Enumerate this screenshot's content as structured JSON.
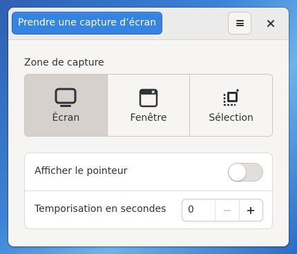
{
  "header": {
    "primary_action_label": "Prendre une capture d’écran",
    "menu_icon": "hamburger-menu-icon",
    "close_icon": "close-icon"
  },
  "capture_area": {
    "label": "Zone de capture",
    "modes": [
      {
        "label": "Écran",
        "icon": "screen-icon",
        "selected": true
      },
      {
        "label": "Fenêtre",
        "icon": "window-icon",
        "selected": false
      },
      {
        "label": "Sélection",
        "icon": "selection-icon",
        "selected": false
      }
    ]
  },
  "options": {
    "show_pointer": {
      "label": "Afficher le pointeur",
      "enabled": false
    },
    "delay": {
      "label": "Temporisation en secondes",
      "value": "0"
    }
  },
  "colors": {
    "accent": "#3584e4",
    "window_bg": "#f6f5f4",
    "selected_mode_bg": "#d6d1cd"
  }
}
